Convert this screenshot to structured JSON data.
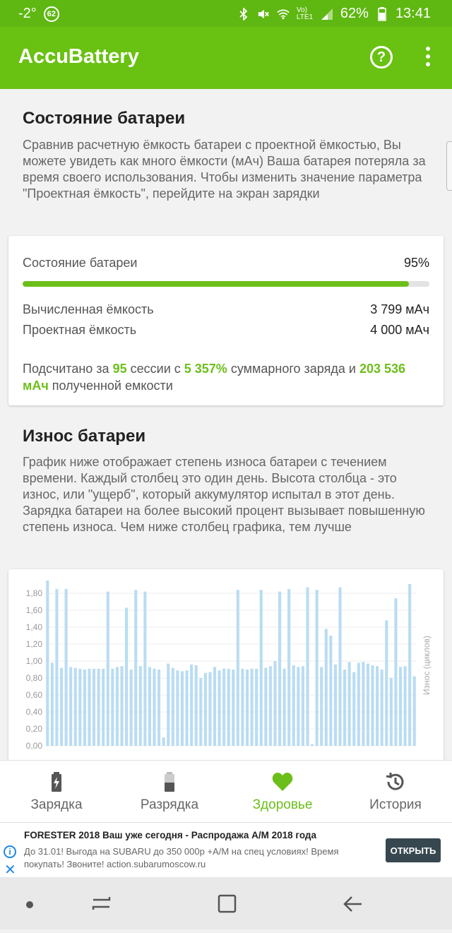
{
  "status_bar": {
    "temperature": "-2°",
    "notification_count": "62",
    "battery_percent": "62%",
    "time": "13:41",
    "network_label": "Vo) LTE1"
  },
  "app_bar": {
    "title": "AccuBattery",
    "help_icon": "help-circle-icon",
    "more_icon": "more-vert-icon"
  },
  "health_section": {
    "title": "Состояние батареи",
    "description": "Сравнив расчетную ёмкость батареи с проектной ёмкостью, Вы можете увидеть как много ёмкости (мАч) Ваша батарея потеряла за время своего использования. Чтобы изменить значение параметра \"Проектная ёмкость\", перейдите на экран зарядки"
  },
  "health_card": {
    "health_label": "Состояние батареи",
    "health_value": "95%",
    "health_fraction": 0.95,
    "estimated_label": "Вычисленная ёмкость",
    "estimated_value": "3 799 мАч",
    "design_label": "Проектная ёмкость",
    "design_value": "4 000 мАч",
    "summary_prefix": "Подсчитано за",
    "sessions": "95",
    "summary_mid1": "сессии с",
    "charge_pct": "5 357%",
    "summary_mid2": "суммарного заряда и",
    "capacity_total": "203 536 мАч",
    "summary_suffix": "полученной емкости"
  },
  "wear_section": {
    "title": "Износ батареи",
    "description": "График ниже отображает степень износа батареи с течением времени. Каждый столбец это один день. Высота столбца - это износ, или \"ущерб\", который аккумулятор испытал в этот день. Зарядка батареи на более высокий процент вызывает повышенную степень износа. Чем ниже столбец графика, тем лучше"
  },
  "chart_data": {
    "type": "bar",
    "ylabel": "Износ (циклов)",
    "ylim": [
      0,
      1.9
    ],
    "yticks": [
      "0,00",
      "0,20",
      "0,40",
      "0,60",
      "0,80",
      "1,00",
      "1,20",
      "1,40",
      "1,60",
      "1,80"
    ],
    "bar_color": "#b9dcf3",
    "values": [
      1.95,
      0.98,
      1.85,
      0.92,
      1.85,
      0.93,
      0.92,
      0.91,
      0.9,
      0.91,
      0.91,
      0.91,
      0.91,
      1.82,
      0.91,
      0.93,
      0.94,
      1.63,
      0.9,
      1.84,
      0.94,
      1.82,
      0.93,
      0.91,
      0.9,
      0.1,
      0.97,
      0.92,
      0.89,
      0.88,
      0.89,
      0.96,
      0.95,
      0.8,
      0.86,
      0.87,
      0.93,
      0.89,
      0.91,
      0.91,
      0.9,
      1.84,
      0.91,
      0.9,
      0.91,
      0.91,
      1.84,
      0.92,
      0.94,
      1.0,
      1.82,
      0.91,
      1.85,
      0.95,
      0.93,
      0.94,
      1.87,
      0.02,
      1.84,
      0.93,
      1.38,
      1.3,
      0.96,
      1.87,
      0.9,
      0.99,
      0.87,
      0.98,
      0.99,
      0.97,
      0.95,
      0.94,
      0.9,
      1.48,
      0.8,
      1.74,
      0.93,
      0.94,
      1.91,
      0.82
    ]
  },
  "bottom_nav": {
    "items": [
      {
        "label": "Зарядка",
        "icon": "battery-charging-icon"
      },
      {
        "label": "Разрядка",
        "icon": "battery-icon"
      },
      {
        "label": "Здоровье",
        "icon": "heart-icon"
      },
      {
        "label": "История",
        "icon": "history-icon"
      }
    ],
    "active_color": "#6cbf1a"
  },
  "ad": {
    "title": "FORESTER 2018 Ваш уже сегодня - Распродажа А/М 2018 года",
    "body": "До 31.01! Выгода на SUBARU до 350 000р +А/М на спец условиях! Время покупать! Звоните! action.subarumoscow.ru",
    "cta": "ОТКРЫТЬ"
  },
  "colors": {
    "status_bar": "#5fb712",
    "app_bar": "#69c112",
    "accent": "#6cbf1a"
  }
}
